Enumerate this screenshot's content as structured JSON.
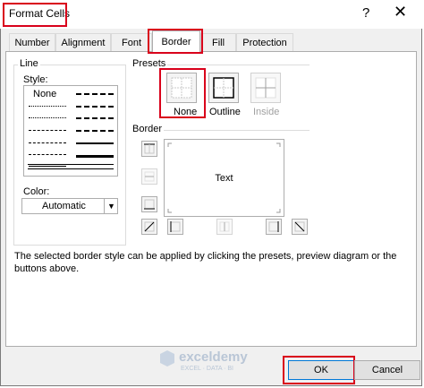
{
  "window": {
    "title": "Format Cells",
    "help_label": "?",
    "close_label": "✕"
  },
  "tabs": [
    {
      "label": "Number"
    },
    {
      "label": "Alignment"
    },
    {
      "label": "Font"
    },
    {
      "label": "Border"
    },
    {
      "label": "Fill"
    },
    {
      "label": "Protection"
    }
  ],
  "line": {
    "group_label": "Line",
    "style_label": "Style:",
    "none_label": "None",
    "color_label": "Color:",
    "color_value": "Automatic"
  },
  "presets": {
    "group_label": "Presets",
    "none": "None",
    "outline": "Outline",
    "inside": "Inside"
  },
  "border": {
    "group_label": "Border",
    "preview_text": "Text"
  },
  "description": "The selected border style can be applied by clicking the presets, preview diagram or the buttons above.",
  "watermark": {
    "brand": "exceldemy",
    "tagline": "EXCEL · DATA · BI"
  },
  "footer": {
    "ok_label": "OK",
    "cancel_label": "Cancel"
  },
  "colors": {
    "highlight": "#d9001b",
    "accent": "#0078d7"
  },
  "icons": [
    "help-icon",
    "close-icon",
    "dropdown-arrow-icon",
    "preset-none-icon",
    "preset-outline-icon",
    "preset-inside-icon",
    "diagonal-icon"
  ]
}
